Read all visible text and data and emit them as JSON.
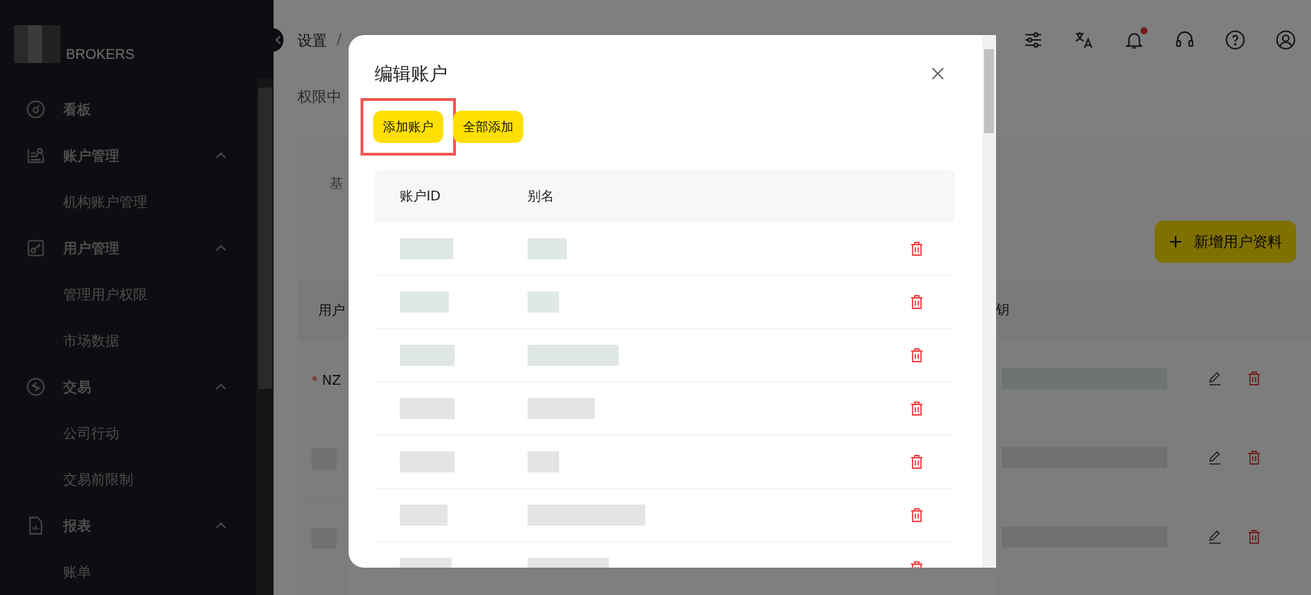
{
  "sidebar": {
    "brand": "BROKERS",
    "items": [
      {
        "kind": "link",
        "label": "看板"
      },
      {
        "kind": "group",
        "label": "账户管理",
        "expanded": true
      },
      {
        "kind": "sub",
        "label": "机构账户管理"
      },
      {
        "kind": "group",
        "label": "用户管理",
        "expanded": true
      },
      {
        "kind": "sub",
        "label": "管理用户权限"
      },
      {
        "kind": "sub",
        "label": "市场数据"
      },
      {
        "kind": "group",
        "label": "交易",
        "expanded": true
      },
      {
        "kind": "sub",
        "label": "公司行动"
      },
      {
        "kind": "sub",
        "label": "交易前限制"
      },
      {
        "kind": "group",
        "label": "报表",
        "expanded": true
      },
      {
        "kind": "sub",
        "label": "账单"
      }
    ]
  },
  "header": {
    "breadcrumb": [
      "设置",
      "/"
    ],
    "notification_dot": true
  },
  "page": {
    "title": "权限中",
    "tab": "基",
    "column_1": "用户",
    "column_2": "钥",
    "required_mark": "*",
    "required_field": "NZ",
    "add_button": "新增用户资料",
    "rows": [
      {
        "redacted": true
      },
      {
        "redacted": true
      },
      {
        "redacted": true
      }
    ]
  },
  "dialog": {
    "title": "编辑账户",
    "buttons": [
      {
        "label": "添加账户",
        "highlighted": true
      },
      {
        "label": "全部添加",
        "highlighted": false
      }
    ],
    "columns": [
      "账户ID",
      "别名"
    ],
    "rows": [
      {
        "redacted": true
      },
      {
        "redacted": true
      },
      {
        "redacted": true
      },
      {
        "redacted": true
      },
      {
        "redacted": true
      },
      {
        "redacted": true
      },
      {
        "redacted": true
      }
    ]
  }
}
